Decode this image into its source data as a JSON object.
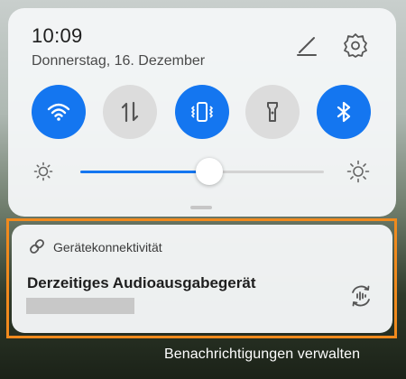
{
  "status": {
    "time": "10:09",
    "date": "Donnerstag, 16. Dezember"
  },
  "header_icons": [
    "edit-icon",
    "settings-icon"
  ],
  "quick_tiles": [
    {
      "name": "wifi-icon",
      "state": "on"
    },
    {
      "name": "mobile-data-icon",
      "state": "off"
    },
    {
      "name": "vibrate-icon",
      "state": "on"
    },
    {
      "name": "flashlight-icon",
      "state": "off"
    },
    {
      "name": "bluetooth-icon",
      "state": "on"
    }
  ],
  "brightness": {
    "level": 0.53,
    "min_icon": "brightness-low-icon",
    "max_icon": "brightness-high-icon"
  },
  "notification": {
    "app_name": "Gerätekonnektivität",
    "title": "Derzeitiges Audioausgabegerät",
    "icon": "link-icon",
    "action_icon": "audio-switch-icon"
  },
  "footer": {
    "manage_label": "Benachrichtigungen verwalten"
  },
  "colors": {
    "accent": "#1476f0",
    "tile_off": "#dcdcdc",
    "highlight": "#f08a1d"
  }
}
